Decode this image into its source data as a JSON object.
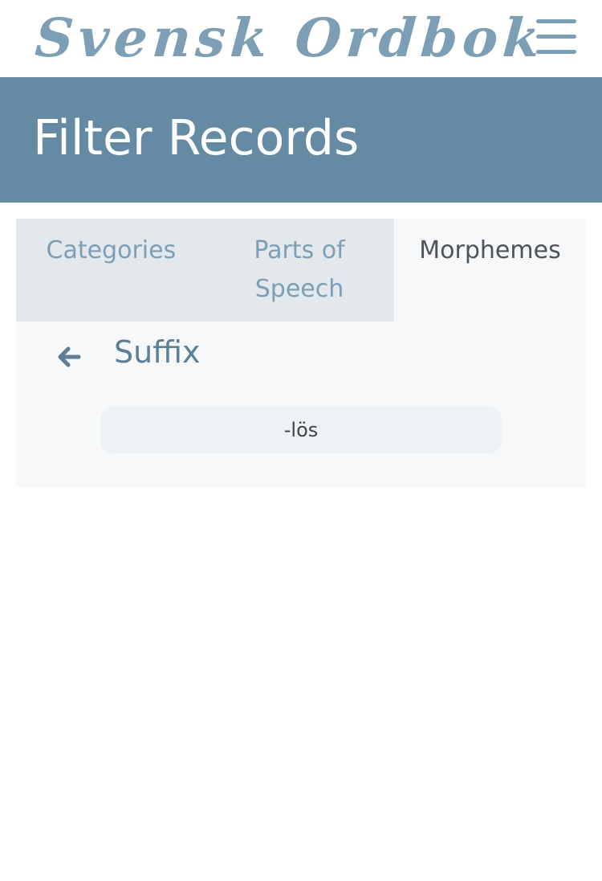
{
  "header": {
    "logo_text": "Svensk Ordbok",
    "menu_icon": "hamburger-menu-icon",
    "accent_color": "#7d9fb5"
  },
  "title_band": {
    "title": "Filter Records",
    "background": "#658aa3"
  },
  "tabs": [
    {
      "label": "Categories",
      "active": false
    },
    {
      "label": "Parts of Speech",
      "active": false
    },
    {
      "label": "Morphemes",
      "active": true
    }
  ],
  "morphemes": {
    "section_label": "Suffix",
    "back_icon": "arrow-left-icon",
    "items": [
      "-lös"
    ]
  }
}
